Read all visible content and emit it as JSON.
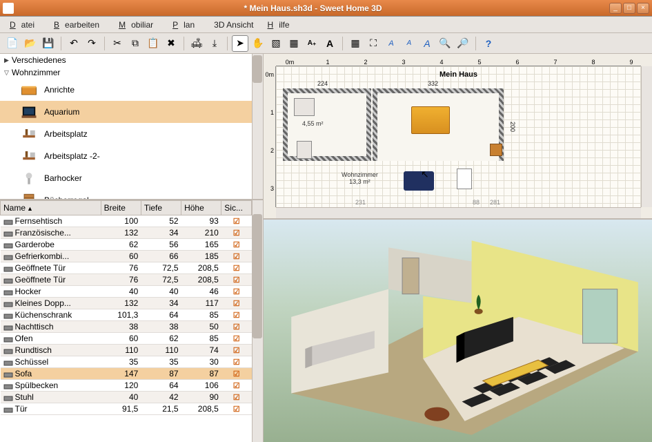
{
  "window": {
    "title": "* Mein Haus.sh3d - Sweet Home 3D",
    "min": "_",
    "max": "□",
    "close": "×"
  },
  "menu": {
    "datei": "Datei",
    "bearbeiten": "Bearbeiten",
    "mobiliar": "Mobiliar",
    "plan": "Plan",
    "ansicht3d": "3D Ansicht",
    "hilfe": "Hilfe"
  },
  "toolbar_icons": [
    "new",
    "open",
    "save",
    "undo",
    "redo",
    "cut",
    "copy",
    "paste",
    "delete",
    "add-furniture",
    "import",
    "select",
    "pan",
    "create-wall",
    "create-room",
    "create-dim",
    "add-text",
    "zoom-grid",
    "zoom-fit",
    "toggle-axes",
    "text-small",
    "text-big",
    "zoom-out",
    "zoom-in",
    "help"
  ],
  "catalog": {
    "cat_verschiedenes": "Verschiedenes",
    "cat_wohnzimmer": "Wohnzimmer",
    "items": [
      {
        "label": "Anrichte",
        "selected": false
      },
      {
        "label": "Aquarium",
        "selected": true
      },
      {
        "label": "Arbeitsplatz",
        "selected": false
      },
      {
        "label": "Arbeitsplatz -2-",
        "selected": false
      },
      {
        "label": "Barhocker",
        "selected": false
      },
      {
        "label": "Bücherregal",
        "selected": false
      }
    ]
  },
  "table": {
    "headers": {
      "name": "Name",
      "breite": "Breite",
      "tiefe": "Tiefe",
      "hoehe": "Höhe",
      "sichtbar": "Sic..."
    },
    "rows": [
      {
        "name": "Fernsehtisch",
        "b": "100",
        "t": "52",
        "h": "93",
        "v": true
      },
      {
        "name": "Französische...",
        "b": "132",
        "t": "34",
        "h": "210",
        "v": true
      },
      {
        "name": "Garderobe",
        "b": "62",
        "t": "56",
        "h": "165",
        "v": true
      },
      {
        "name": "Gefrierkombi...",
        "b": "60",
        "t": "66",
        "h": "185",
        "v": true
      },
      {
        "name": "Geöffnete Tür",
        "b": "76",
        "t": "72,5",
        "h": "208,5",
        "v": true
      },
      {
        "name": "Geöffnete Tür",
        "b": "76",
        "t": "72,5",
        "h": "208,5",
        "v": true
      },
      {
        "name": "Hocker",
        "b": "40",
        "t": "40",
        "h": "46",
        "v": true
      },
      {
        "name": "Kleines Dopp...",
        "b": "132",
        "t": "34",
        "h": "117",
        "v": true
      },
      {
        "name": "Küchenschrank",
        "b": "101,3",
        "t": "64",
        "h": "85",
        "v": true
      },
      {
        "name": "Nachttisch",
        "b": "38",
        "t": "38",
        "h": "50",
        "v": true
      },
      {
        "name": "Ofen",
        "b": "60",
        "t": "62",
        "h": "85",
        "v": true
      },
      {
        "name": "Rundtisch",
        "b": "110",
        "t": "110",
        "h": "74",
        "v": true
      },
      {
        "name": "Schüssel",
        "b": "35",
        "t": "35",
        "h": "30",
        "v": true
      },
      {
        "name": "Sofa",
        "b": "147",
        "t": "87",
        "h": "87",
        "v": true,
        "selected": true
      },
      {
        "name": "Spülbecken",
        "b": "120",
        "t": "64",
        "h": "106",
        "v": true
      },
      {
        "name": "Stuhl",
        "b": "40",
        "t": "42",
        "h": "90",
        "v": true
      },
      {
        "name": "Tür",
        "b": "91,5",
        "t": "21,5",
        "h": "208,5",
        "v": true
      }
    ]
  },
  "plan": {
    "house_name": "Mein Haus",
    "ruler_h": [
      "0m",
      "1",
      "2",
      "3",
      "4",
      "5",
      "6",
      "7",
      "8",
      "9"
    ],
    "ruler_v": [
      "0m",
      "1",
      "2",
      "3"
    ],
    "dim_left": "224",
    "dim_right": "332",
    "dim_h": "200",
    "room1_area": "4,55 m²",
    "room2_name": "Wohnzimmer",
    "room2_area": "13,3 m²",
    "num_left": "231",
    "num_right": "88",
    "num_far": "281"
  }
}
